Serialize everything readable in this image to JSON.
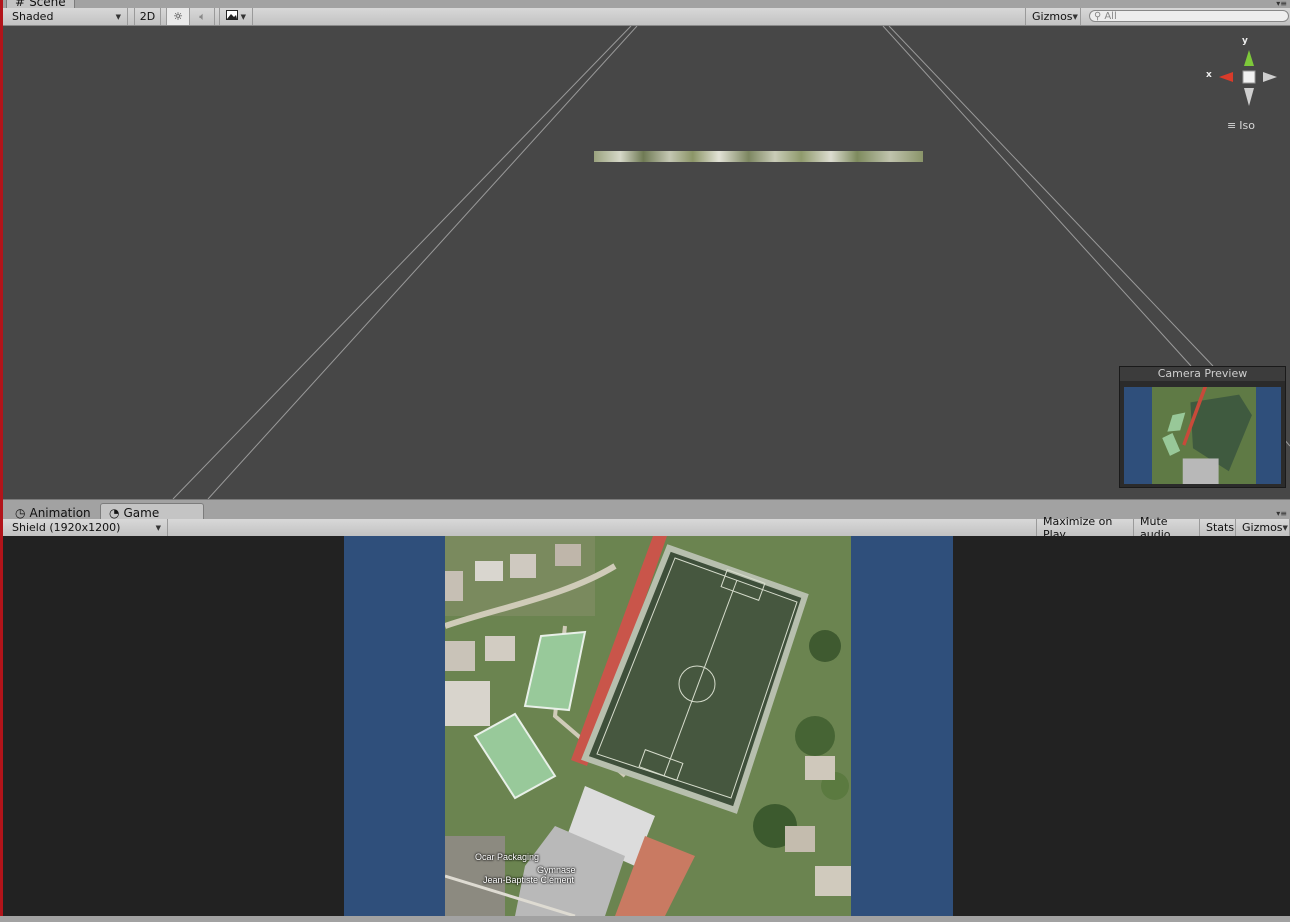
{
  "scene_panel": {
    "tab_label": "Scene",
    "shading_mode": "Shaded",
    "mode_2d_label": "2D",
    "gizmos_label": "Gizmos",
    "search_placeholder": "All",
    "axis_y": "y",
    "axis_x": "x",
    "projection_label": "Iso",
    "camera_preview_title": "Camera Preview"
  },
  "game_panel": {
    "tabs": [
      {
        "label": "Animation",
        "icon": "clock-icon",
        "active": false
      },
      {
        "label": "Game",
        "icon": "pacman-icon",
        "active": true
      }
    ],
    "resolution": "Shield (1920x1200)",
    "buttons": {
      "maximize": "Maximize on Play",
      "mute": "Mute audio",
      "stats": "Stats",
      "gizmos": "Gizmos"
    },
    "map_labels": {
      "packaging": "Ocar Packaging",
      "gymnase": "Gymnase",
      "school": "Jean-Baptiste Clément"
    }
  },
  "colors": {
    "scene_background": "#474747",
    "camera_background": "#2f4f7b",
    "window_edge": "#b2141a",
    "axis_y_color": "#7ec93a",
    "axis_x_color": "#d93b2a"
  }
}
